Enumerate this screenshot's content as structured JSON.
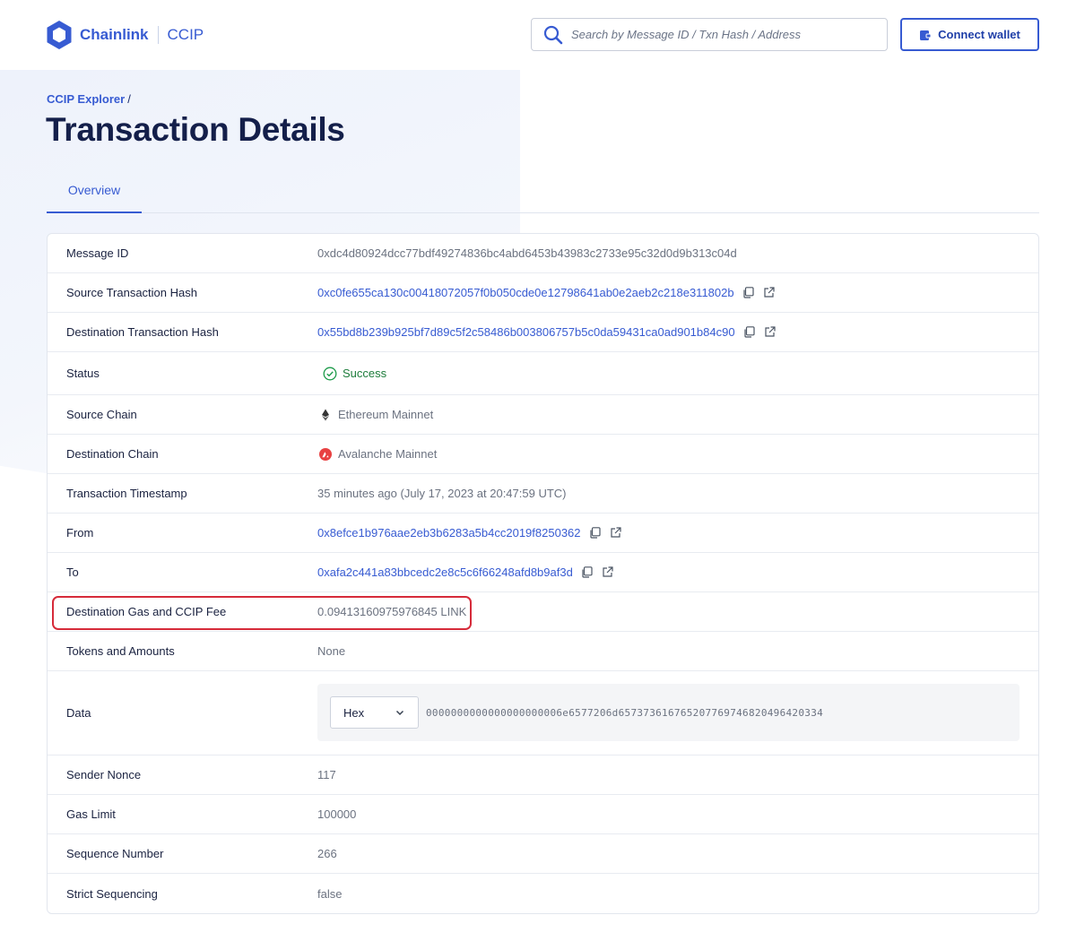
{
  "header": {
    "brand": "Chainlink",
    "product": "CCIP",
    "search_placeholder": "Search by Message ID / Txn Hash / Address",
    "connect_label": "Connect wallet"
  },
  "breadcrumb": {
    "root": "CCIP Explorer",
    "separator": "/"
  },
  "page": {
    "title": "Transaction Details"
  },
  "tabs": [
    {
      "label": "Overview",
      "active": true
    }
  ],
  "details": {
    "message_id": {
      "label": "Message ID",
      "value": "0xdc4d80924dcc77bdf49274836bc4abd6453b43983c2733e95c32d0d9b313c04d"
    },
    "source_tx": {
      "label": "Source Transaction Hash",
      "value": "0xc0fe655ca130c00418072057f0b050cde0e12798641ab0e2aeb2c218e311802b"
    },
    "dest_tx": {
      "label": "Destination Transaction Hash",
      "value": "0x55bd8b239b925bf7d89c5f2c58486b003806757b5c0da59431ca0ad901b84c90"
    },
    "status": {
      "label": "Status",
      "value": "Success"
    },
    "source_chain": {
      "label": "Source Chain",
      "value": "Ethereum Mainnet"
    },
    "dest_chain": {
      "label": "Destination Chain",
      "value": "Avalanche Mainnet"
    },
    "timestamp": {
      "label": "Transaction Timestamp",
      "value": "35 minutes ago (July 17, 2023 at 20:47:59 UTC)"
    },
    "from": {
      "label": "From",
      "value": "0x8efce1b976aae2eb3b6283a5b4cc2019f8250362"
    },
    "to": {
      "label": "To",
      "value": "0xafa2c441a83bbcedc2e8c5c6f66248afd8b9af3d"
    },
    "fee": {
      "label": "Destination Gas and CCIP Fee",
      "value": "0.09413160975976845 LINK"
    },
    "tokens": {
      "label": "Tokens and Amounts",
      "value": "None"
    },
    "data": {
      "label": "Data",
      "format": "Hex",
      "value": "0000000000000000000006e6577206d657373616765207769746820496420334"
    },
    "sender_nonce": {
      "label": "Sender Nonce",
      "value": "117"
    },
    "gas_limit": {
      "label": "Gas Limit",
      "value": "100000"
    },
    "sequence_number": {
      "label": "Sequence Number",
      "value": "266"
    },
    "strict_sequencing": {
      "label": "Strict Sequencing",
      "value": "false"
    }
  },
  "colors": {
    "accent": "#375bd2",
    "success": "#1d7c3b",
    "highlight": "#d62b3a",
    "avalanche": "#e84142"
  }
}
